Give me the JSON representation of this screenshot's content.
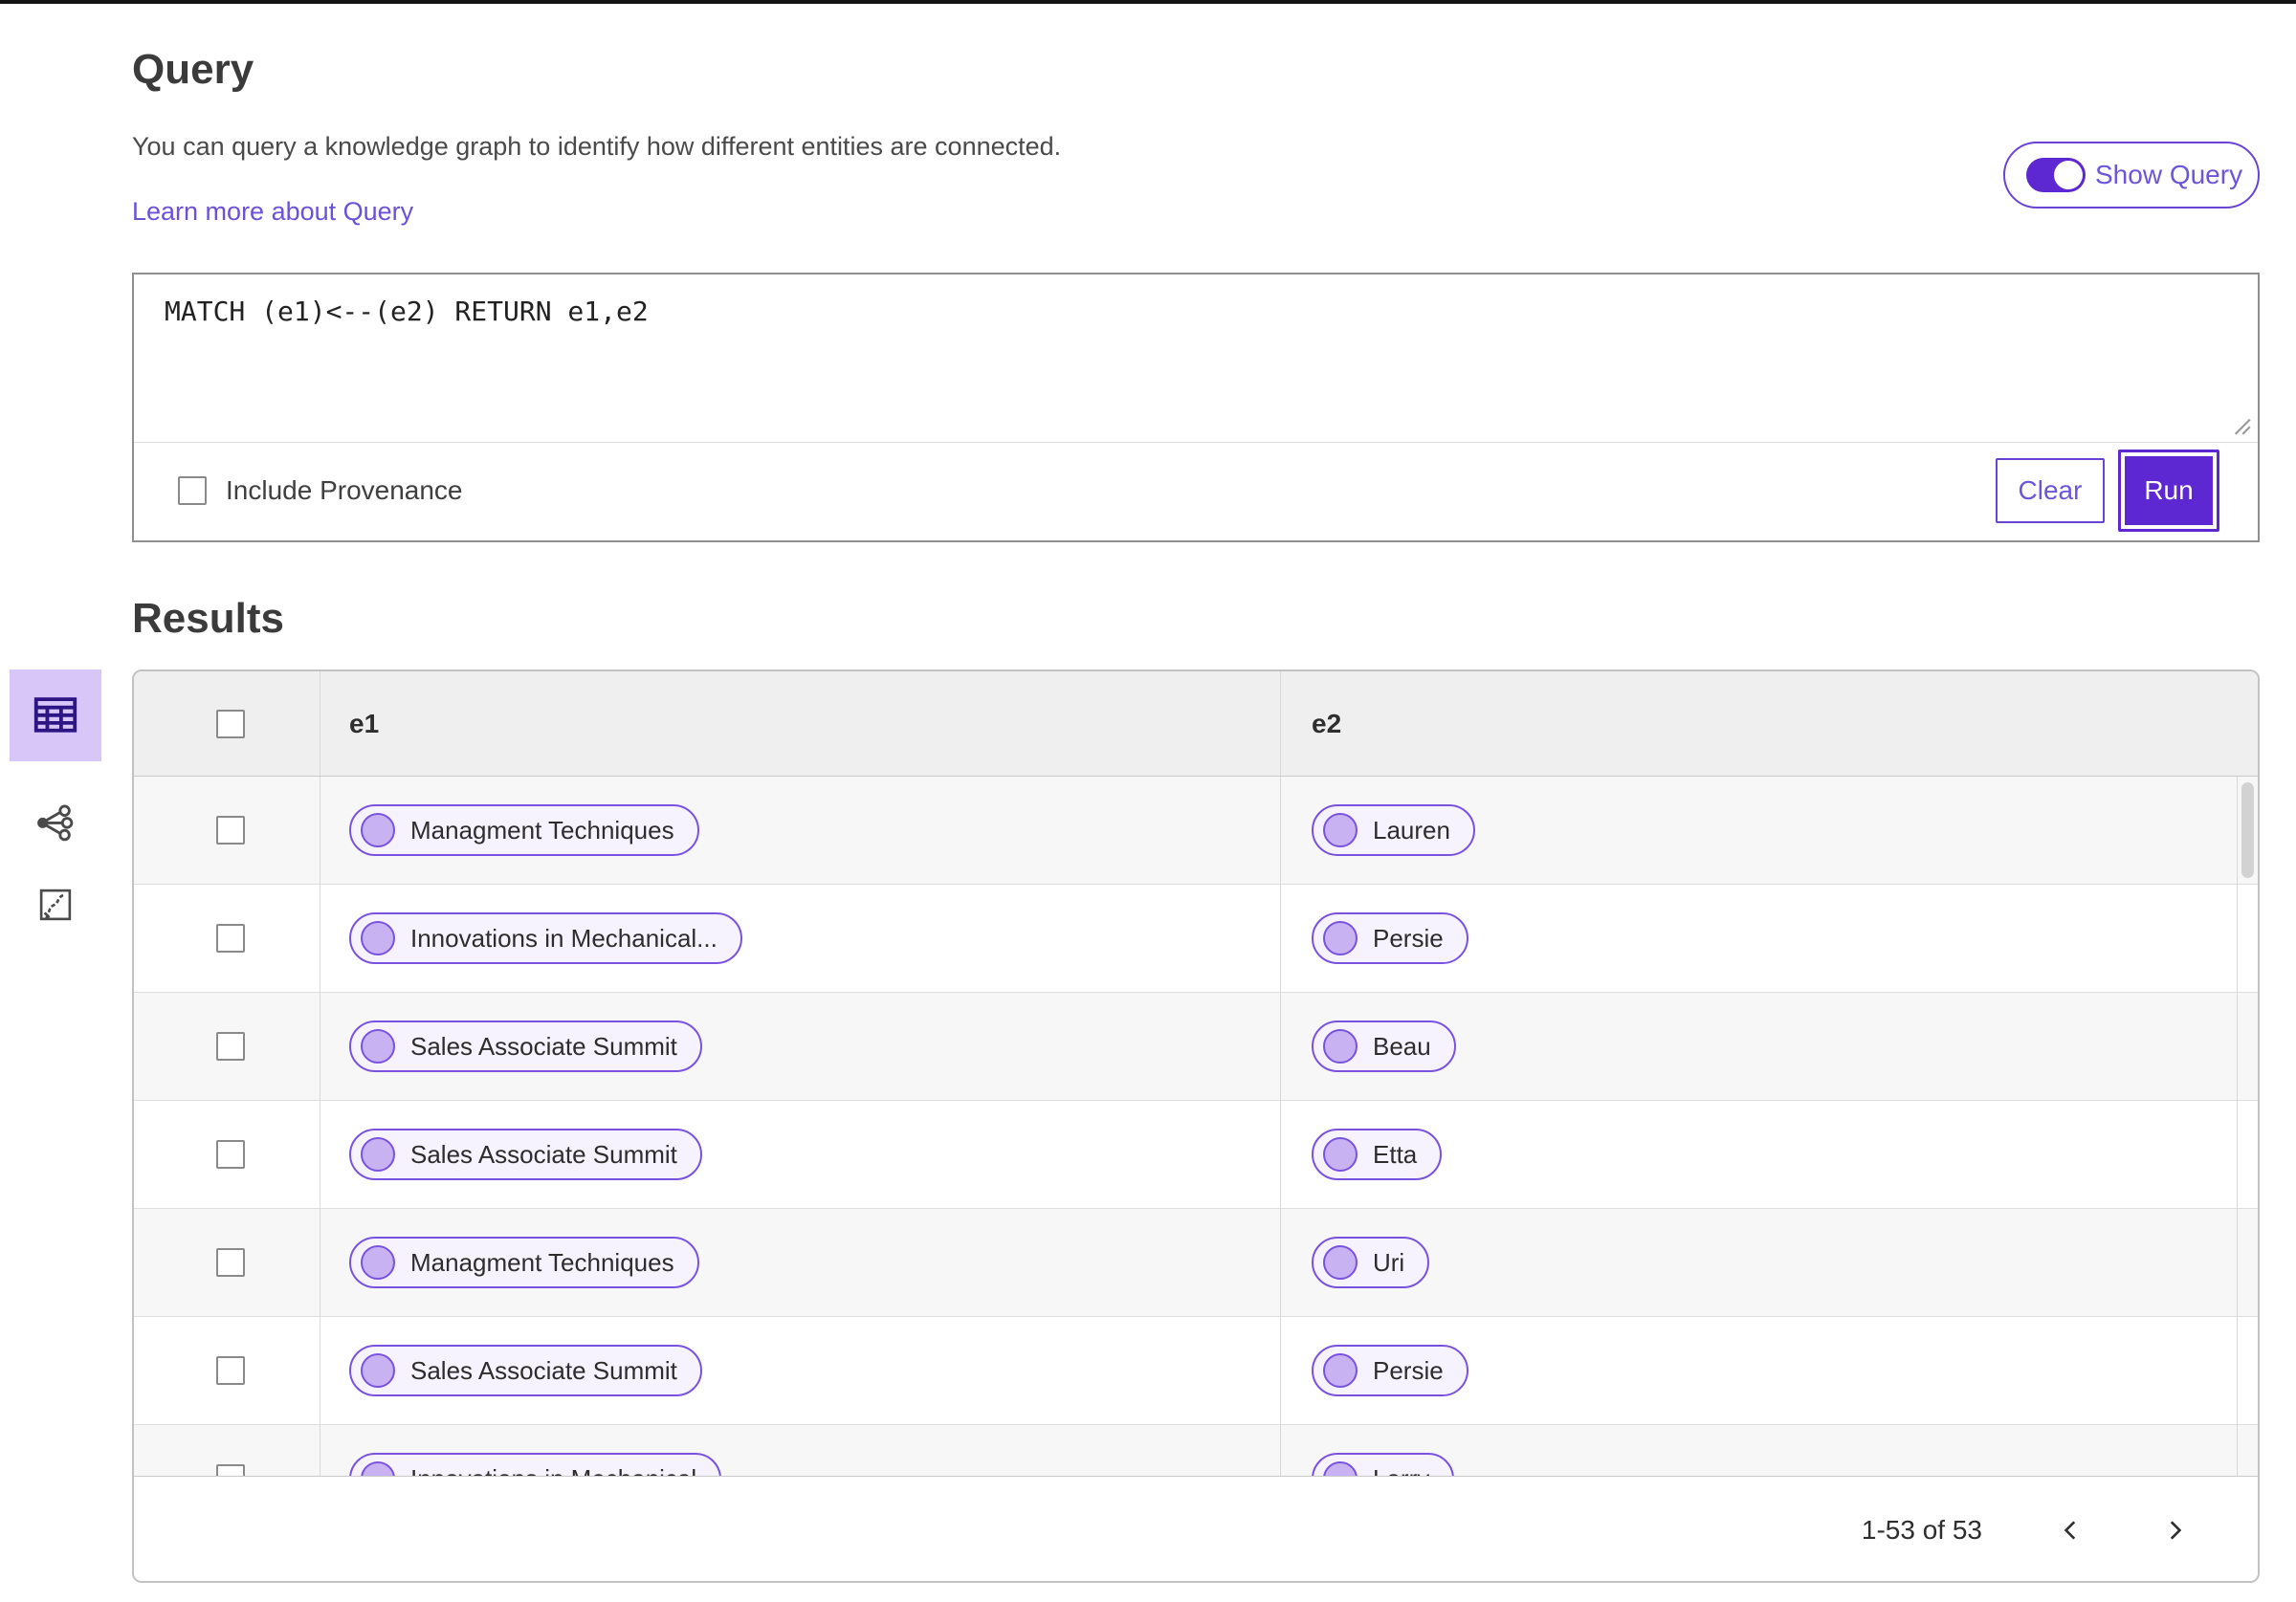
{
  "colors": {
    "accent_purple": "#5d28d2",
    "pill_border_purple": "#7a52e0",
    "pill_background": "#f6f3fe",
    "pill_circle_fill": "#c9b2f1",
    "link_purple": "#6a52d8",
    "rail_selected_background": "#d9c6f8",
    "header_row_background": "#efefef",
    "odd_row_background": "#f7f7f7"
  },
  "query_section": {
    "title": "Query",
    "description": "You can query a knowledge graph to identify how different entities are connected.",
    "learn_more_link": "Learn more about Query",
    "show_query_label": "Show Query",
    "show_query_toggle_state": "on",
    "editor_text": "MATCH (e1)<--(e2) RETURN e1,e2",
    "include_provenance_label": "Include Provenance",
    "include_provenance_checked": false,
    "clear_label": "Clear",
    "run_label": "Run"
  },
  "results_section": {
    "title": "Results",
    "view_switcher": [
      {
        "name": "table-view",
        "icon": "table-icon",
        "selected": true
      },
      {
        "name": "graph-view",
        "icon": "graph-nodes-icon",
        "selected": false
      },
      {
        "name": "chart-view",
        "icon": "chart-box-icon",
        "selected": false
      }
    ],
    "columns": [
      "e1",
      "e2"
    ],
    "rows": [
      {
        "e1": "Managment Techniques",
        "e2": "Lauren"
      },
      {
        "e1": "Innovations in Mechanical...",
        "e2": "Persie"
      },
      {
        "e1": "Sales Associate Summit",
        "e2": "Beau"
      },
      {
        "e1": "Sales Associate Summit",
        "e2": "Etta"
      },
      {
        "e1": "Managment Techniques",
        "e2": "Uri"
      },
      {
        "e1": "Sales Associate Summit",
        "e2": "Persie"
      },
      {
        "e1": "Innovations in Mechanical",
        "e2": "Larry"
      }
    ],
    "pagination": {
      "range_text": "1-53 of 53"
    }
  }
}
